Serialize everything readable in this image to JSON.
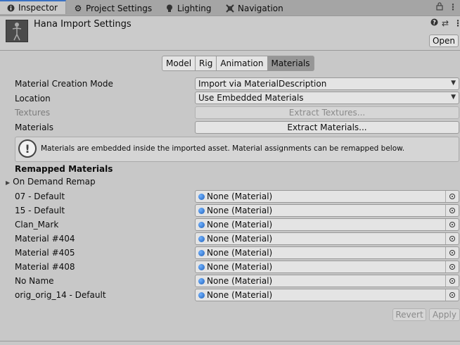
{
  "tabs": {
    "inspector": "Inspector",
    "project_settings": "Project Settings",
    "lighting": "Lighting",
    "navigation": "Navigation"
  },
  "header": {
    "title": "Hana Import Settings",
    "open_label": "Open"
  },
  "subtabs": [
    "Model",
    "Rig",
    "Animation",
    "Materials"
  ],
  "selected_subtab": "Materials",
  "settings": {
    "material_creation_mode": {
      "label": "Material Creation Mode",
      "value": "Import via MaterialDescription"
    },
    "location": {
      "label": "Location",
      "value": "Use Embedded Materials"
    },
    "textures": {
      "label": "Textures",
      "button": "Extract Textures..."
    },
    "materials": {
      "label": "Materials",
      "button": "Extract Materials..."
    }
  },
  "info_message": "Materials are embedded inside the imported asset. Material assignments can be remapped below.",
  "remapped": {
    "title": "Remapped Materials",
    "foldout": "On Demand Remap",
    "rows": [
      {
        "name": "07 - Default",
        "value": "None (Material)"
      },
      {
        "name": "15 - Default",
        "value": "None (Material)"
      },
      {
        "name": "Clan_Mark",
        "value": "None (Material)"
      },
      {
        "name": "Material #404",
        "value": "None (Material)"
      },
      {
        "name": "Material #405",
        "value": "None (Material)"
      },
      {
        "name": "Material #408",
        "value": "None (Material)"
      },
      {
        "name": "No Name",
        "value": "None (Material)"
      },
      {
        "name": "orig_orig_14 - Default",
        "value": "None (Material)"
      }
    ]
  },
  "footer": {
    "revert": "Revert",
    "apply": "Apply"
  },
  "colors": {
    "accent": "#3a72c4",
    "background": "#c8c8c8",
    "selected_tab": "#969696"
  }
}
